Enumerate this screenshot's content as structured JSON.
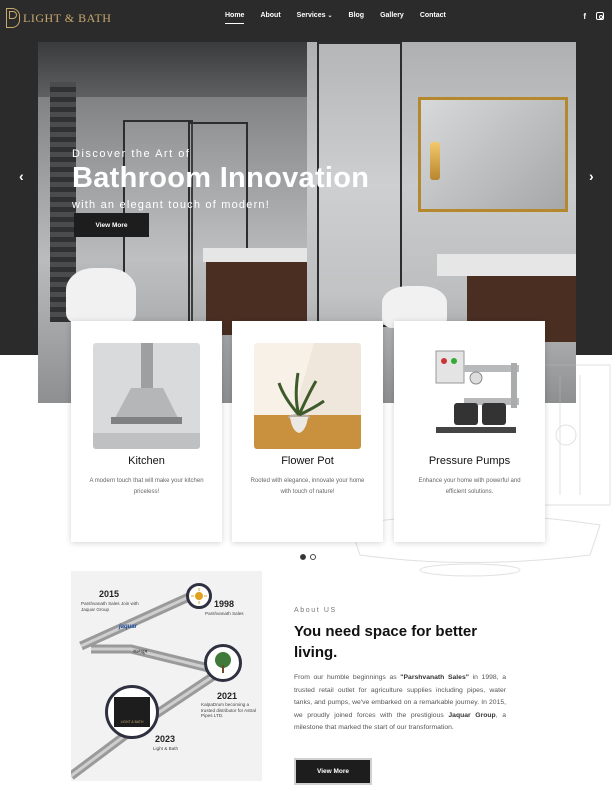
{
  "brand": {
    "name": "LIGHT & BATH",
    "color": "#c8a96e"
  },
  "nav": {
    "items": [
      {
        "label": "Home",
        "active": true
      },
      {
        "label": "About"
      },
      {
        "label": "Services",
        "dropdown": true
      },
      {
        "label": "Blog"
      },
      {
        "label": "Gallery"
      },
      {
        "label": "Contact"
      }
    ],
    "dropdown_chevron": "⌄"
  },
  "social": {
    "facebook": "f",
    "instagram_icon": "instagram-icon"
  },
  "hero": {
    "kicker": "Discover the Art of",
    "title": "Bathroom Innovation",
    "subtitle": "with an elegant touch of modern!",
    "button": "View More",
    "prev_icon": "‹",
    "next_icon": "›"
  },
  "cards": [
    {
      "title": "Kitchen",
      "desc": "A modern touch that will make your kitchen priceless!"
    },
    {
      "title": "Flower Pot",
      "desc": "Rooted with elegance, innovate your home with touch of nature!"
    },
    {
      "title": "Pressure Pumps",
      "desc": "Enhance your home with powerful and efficient solutions."
    }
  ],
  "carousel": {
    "active_index": 0,
    "count": 2
  },
  "timeline": {
    "y2015": "2015",
    "n2015": "Parshvanath Sales Join with Jaquar Group",
    "y1998": "1998",
    "n1998": "Parshvanath Sales",
    "y2021": "2021",
    "n2021": "KalpaDrum becoming a trusted distributor for Astral Pipes LTD.",
    "y2023": "2023",
    "n2023": "Light & Bath",
    "jaquar_logo": "jaquar",
    "kalpa_logo": "कल्पद्रुम",
    "lb_logo": "LIGHT & BATH"
  },
  "about": {
    "kicker": "About US",
    "title": "You need space for better living.",
    "body_1": "From our humble beginnings as ",
    "body_b1": "\"Parshvanath Sales\"",
    "body_2": " in 1998, a trusted retail outlet for agriculture supplies including pipes, water tanks, and pumps, we've embarked on a remarkable journey. In 2015, we proudly joined forces with the prestigious ",
    "body_b2": "Jaquar Group",
    "body_3": ", a milestone that marked the start of our transformation.",
    "button": "View More"
  }
}
